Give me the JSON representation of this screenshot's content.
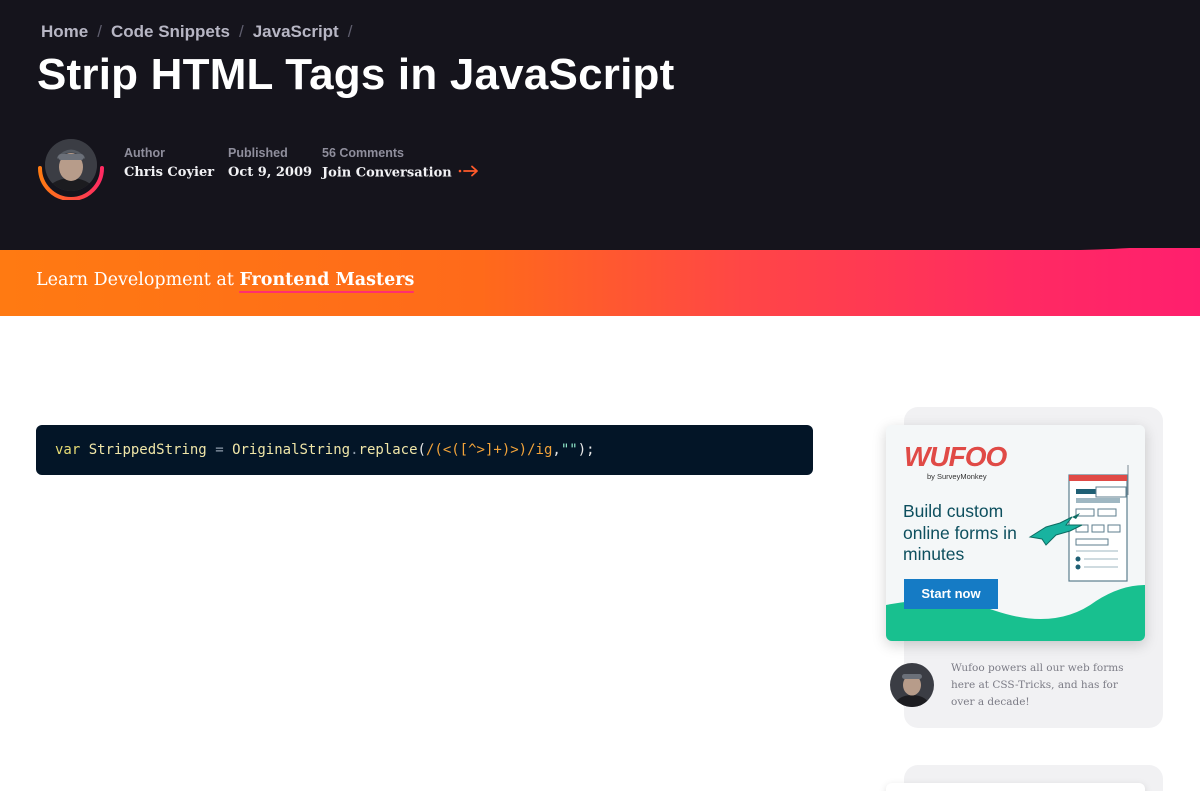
{
  "breadcrumb": {
    "items": [
      "Home",
      "Code Snippets",
      "JavaScript"
    ],
    "separator": "/"
  },
  "article": {
    "title": "Strip HTML Tags in JavaScript"
  },
  "meta": {
    "author_label": "Author",
    "author_name": "Chris Coyier",
    "published_label": "Published",
    "published_date": "Oct 9, 2009",
    "comments_label": "56 Comments",
    "comments_link": "Join Conversation"
  },
  "promo": {
    "prefix": "Learn Development at",
    "brand": "Frontend Masters"
  },
  "code": {
    "language": "javascript",
    "tokens": {
      "kw": "var",
      "id": "StrippedString",
      "op": "=",
      "obj": "OriginalString",
      "dot": ".",
      "fn": "replace",
      "open": "(",
      "regex": "/(<([^>]+)>)/ig",
      "comma": ",",
      "str": "\"\"",
      "close": ");"
    }
  },
  "sidebar": {
    "ad": {
      "logo": "WUFOO",
      "byline": "by SurveyMonkey",
      "headline": "Build custom online forms in minutes",
      "cta": "Start now"
    },
    "note": "Wufoo powers all our web forms here at CSS-Tricks, and has for over a decade!"
  },
  "colors": {
    "header_bg": "#15141c",
    "promo_start": "#ff7a12",
    "promo_end": "#ff1f6e",
    "code_bg": "#031527",
    "ad_button": "#157bc5",
    "ad_wave": "#18c08f",
    "wufoo_red": "#e04a46"
  }
}
